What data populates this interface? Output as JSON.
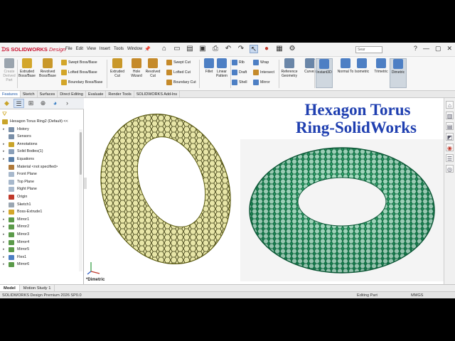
{
  "app": {
    "brand": "SOLIDWORKS",
    "brand_suffix": "Design",
    "menus": [
      "File",
      "Edit",
      "View",
      "Insert",
      "Tools",
      "Window"
    ],
    "search_placeholder": "Sear"
  },
  "ribbon": {
    "big_buttons": [
      {
        "id": "create-derived-part",
        "label": "Create Derived Part",
        "icon": "derived-part-icon",
        "color": "#9aa4ae",
        "dim": true
      },
      {
        "id": "extruded-boss",
        "label": "Extruded Boss/Base",
        "icon": "extrude-boss-icon",
        "color": "#d3a62a"
      },
      {
        "id": "revolved-boss",
        "label": "Revolved Boss/Base",
        "icon": "revolve-boss-icon",
        "color": "#c9982a"
      },
      {
        "id": "extruded-cut",
        "label": "Extruded Cut",
        "icon": "extrude-cut-icon",
        "color": "#c9982a"
      },
      {
        "id": "hole-wizard",
        "label": "Hole Wizard",
        "icon": "hole-wizard-icon",
        "color": "#c58a2a"
      },
      {
        "id": "revolved-cut",
        "label": "Revolved Cut",
        "icon": "revolve-cut-icon",
        "color": "#c58a2a"
      },
      {
        "id": "fillet",
        "label": "Fillet",
        "icon": "fillet-icon",
        "color": "#4d7fc4"
      },
      {
        "id": "linear-pattern",
        "label": "Linear Pattern",
        "icon": "linear-pattern-icon",
        "color": "#4d7fc4"
      },
      {
        "id": "reference-geometry",
        "label": "Reference Geometry",
        "icon": "reference-geometry-icon",
        "color": "#6a86a8"
      },
      {
        "id": "curves",
        "label": "Curves",
        "icon": "curves-icon",
        "color": "#6a86a8"
      },
      {
        "id": "instant3d",
        "label": "Instant3D",
        "icon": "instant3d-icon",
        "color": "#4d7fc4"
      },
      {
        "id": "normal-to",
        "label": "Normal To",
        "icon": "normal-to-icon",
        "color": "#4d7fc4"
      },
      {
        "id": "isometric",
        "label": "Isometric",
        "icon": "isometric-icon",
        "color": "#4d7fc4"
      },
      {
        "id": "trimetric",
        "label": "Trimetric",
        "icon": "trimetric-icon",
        "color": "#4d7fc4"
      },
      {
        "id": "dimetric",
        "label": "Dimetric",
        "icon": "dimetric-icon",
        "color": "#4d7fc4"
      }
    ],
    "small_buttons": [
      {
        "id": "swept-boss",
        "label": "Swept Boss/Base",
        "icon": "swept-boss-icon",
        "color": "#d3a62a"
      },
      {
        "id": "lofted-boss",
        "label": "Lofted Boss/Base",
        "icon": "lofted-boss-icon",
        "color": "#d3a62a"
      },
      {
        "id": "boundary-boss",
        "label": "Boundary Boss/Base",
        "icon": "boundary-boss-icon",
        "color": "#d3a62a"
      },
      {
        "id": "swept-cut",
        "label": "Swept Cut",
        "icon": "swept-cut-icon",
        "color": "#c58a2a"
      },
      {
        "id": "lofted-cut",
        "label": "Lofted Cut",
        "icon": "lofted-cut-icon",
        "color": "#c58a2a"
      },
      {
        "id": "boundary-cut",
        "label": "Boundary Cut",
        "icon": "boundary-cut-icon",
        "color": "#c58a2a"
      },
      {
        "id": "rib",
        "label": "Rib",
        "icon": "rib-icon",
        "color": "#4d7fc4"
      },
      {
        "id": "draft",
        "label": "Draft",
        "icon": "draft-icon",
        "color": "#4d7fc4"
      },
      {
        "id": "shell",
        "label": "Shell",
        "icon": "shell-icon",
        "color": "#4d7fc4"
      },
      {
        "id": "wrap",
        "label": "Wrap",
        "icon": "wrap-icon",
        "color": "#4d7fc4"
      },
      {
        "id": "intersect",
        "label": "Intersect",
        "icon": "intersect-icon",
        "color": "#c58a2a"
      },
      {
        "id": "mirror",
        "label": "Mirror",
        "icon": "mirror-icon",
        "color": "#4d7fc4"
      }
    ]
  },
  "command_tabs": [
    "Features",
    "Sketch",
    "Surfaces",
    "Direct Editing",
    "Evaluate",
    "Render Tools",
    "SOLIDWORKS Add-Ins"
  ],
  "tree": {
    "root": "Hexagon Torus Ring2 (Default) <<",
    "items": [
      {
        "label": "History",
        "icon": "history-icon",
        "color": "#7a8fa8"
      },
      {
        "label": "Sensors",
        "icon": "sensor-icon",
        "color": "#7a8fa8"
      },
      {
        "label": "Annotations",
        "icon": "annotation-icon",
        "color": "#c9a42a"
      },
      {
        "label": "Solid Bodies(1)",
        "icon": "solid-bodies-icon",
        "color": "#8a9fb8"
      },
      {
        "label": "Equations",
        "icon": "equations-icon",
        "color": "#5a7fa8"
      },
      {
        "label": "Material <not specified>",
        "icon": "material-icon",
        "color": "#b07a3a"
      },
      {
        "label": "Front Plane",
        "icon": "plane-icon",
        "color": "#a7b8cc"
      },
      {
        "label": "Top Plane",
        "icon": "plane-icon",
        "color": "#a7b8cc"
      },
      {
        "label": "Right Plane",
        "icon": "plane-icon",
        "color": "#a7b8cc"
      },
      {
        "label": "Origin",
        "icon": "origin-icon",
        "color": "#c0392b"
      },
      {
        "label": "Sketch1",
        "icon": "sketch-icon",
        "color": "#9aa6b2"
      },
      {
        "label": "Boss-Extrude1",
        "icon": "boss-extrude-icon",
        "color": "#d3a62a"
      },
      {
        "label": "Mirror1",
        "icon": "mirror-feature-icon",
        "color": "#5b9a4a"
      },
      {
        "label": "Mirror2",
        "icon": "mirror-feature-icon",
        "color": "#5b9a4a"
      },
      {
        "label": "Mirror3",
        "icon": "mirror-feature-icon",
        "color": "#5b9a4a"
      },
      {
        "label": "Mirror4",
        "icon": "mirror-feature-icon",
        "color": "#5b9a4a"
      },
      {
        "label": "Mirror5",
        "icon": "mirror-feature-icon",
        "color": "#5b9a4a"
      },
      {
        "label": "Flex1",
        "icon": "flex-icon",
        "color": "#4d7fc4"
      },
      {
        "label": "Mirror6",
        "icon": "mirror-feature-icon",
        "color": "#5b9a4a"
      }
    ]
  },
  "viewport": {
    "title_line1": "Hexagon Torus",
    "title_line2": "Ring-SolidWorks",
    "view_label": "*Dimetric",
    "model_color": "#c8c44a",
    "render_color": "#1f8a5a"
  },
  "bottom_tabs": [
    "Model",
    "Motion Study 1"
  ],
  "status": {
    "left": "SOLIDWORKS Design Premium 2026 SP0.0",
    "mode": "Editing Part",
    "units": "MMGS"
  }
}
